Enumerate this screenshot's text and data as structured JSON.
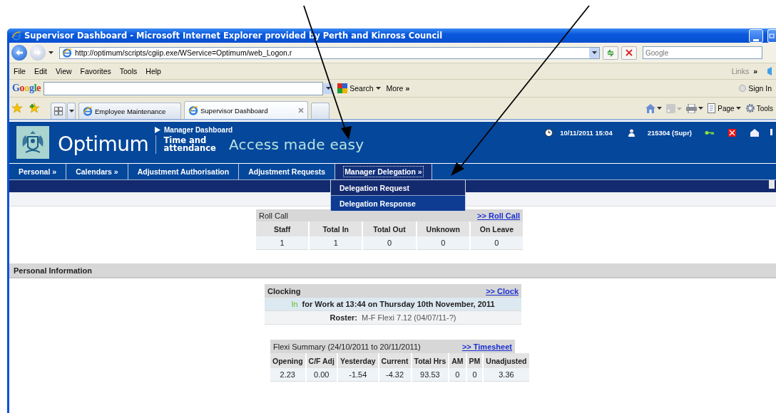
{
  "window": {
    "title": "Supervisor Dashboard - Microsoft Internet Explorer provided by Perth and Kinross Council"
  },
  "address_bar": {
    "url": "http://optimum/scripts/cgiip.exe/WService=Optimum/web_Logon.r",
    "search_placeholder": "Google"
  },
  "menu_bar": {
    "items": [
      "File",
      "Edit",
      "View",
      "Favorites",
      "Tools",
      "Help"
    ],
    "links_label": "Links",
    "links_chevron": "»"
  },
  "google_toolbar": {
    "logo": "Google",
    "search_label": "Search",
    "more_label": "More",
    "more_chevron": "»",
    "sign_in": "Sign In"
  },
  "browser_tabs": [
    {
      "label": "Employee Maintenance",
      "selected": false
    },
    {
      "label": "Supervisor Dashboard",
      "selected": true
    }
  ],
  "command_bar": {
    "page": "Page",
    "tools": "Tools"
  },
  "app_header": {
    "breadcrumb": "Manager Dashboard",
    "brand": "Optimum",
    "product_line1": "Time and",
    "product_line2": "attendance",
    "tagline": "Access made easy",
    "datetime": "10/11/2011 15:04",
    "user": "215304 (Supr)"
  },
  "nav": [
    {
      "label": "Personal »",
      "selected": false
    },
    {
      "label": "Calendars »",
      "selected": false
    },
    {
      "label": "Adjustment Authorisation",
      "selected": false
    },
    {
      "label": "Adjustment Requests",
      "selected": false
    },
    {
      "label": "Manager Delegation »",
      "selected": true
    }
  ],
  "nav_dropdown": [
    "Delegation Request",
    "Delegation Response"
  ],
  "roll_call": {
    "title": "Roll Call",
    "link": ">> Roll Call",
    "columns": [
      "Staff",
      "Total In",
      "Total Out",
      "Unknown",
      "On Leave"
    ],
    "rows": [
      [
        "1",
        "1",
        "0",
        "0",
        "0"
      ]
    ]
  },
  "personal_information": {
    "title": "Personal Information"
  },
  "clocking": {
    "title": "Clocking",
    "link": ">> Clock",
    "status": "In",
    "status_detail": "for Work at 13:44 on Thursday 10th November, 2011",
    "roster_label": "Roster:",
    "roster_value": "M-F Flexi 7.12 (04/07/11-?)"
  },
  "flexi_summary": {
    "title": "Flexi Summary (24/10/2011 to 20/11/2011)",
    "link": ">> Timesheet",
    "columns": [
      "Opening",
      "C/F Adj",
      "Yesterday",
      "Current",
      "Total Hrs",
      "AM",
      "PM",
      "Unadjusted"
    ],
    "rows": [
      [
        "2.23",
        "0.00",
        "-1.54",
        "-4.32",
        "93.53",
        "0",
        "0",
        "3.36"
      ]
    ]
  }
}
